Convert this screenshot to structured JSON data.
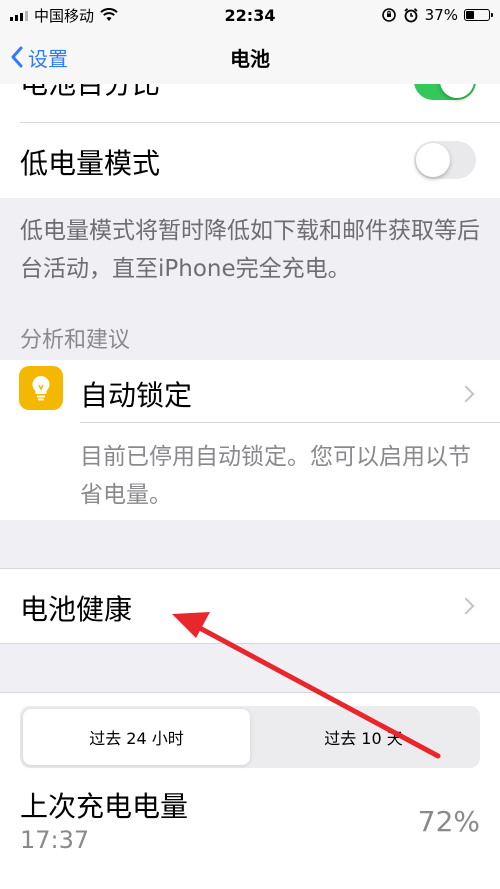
{
  "status_bar": {
    "carrier": "中国移动",
    "time": "22:34",
    "battery_percent": "37%",
    "battery_level": 0.37
  },
  "nav": {
    "back_label": "设置",
    "title": "电池"
  },
  "settings": {
    "battery_percentage": {
      "label": "电池百分比",
      "on": true
    },
    "low_power_mode": {
      "label": "低电量模式",
      "on": false
    },
    "low_power_desc": "低电量模式将暂时降低如下载和邮件获取等后台活动，直至iPhone完全充电。"
  },
  "insights": {
    "header": "分析和建议",
    "auto_lock_label": "自动锁定",
    "auto_lock_desc": "目前已停用自动锁定。您可以启用以节省电量。"
  },
  "battery_health": {
    "label": "电池健康"
  },
  "usage": {
    "tabs": [
      "过去 24 小时",
      "过去 10 天"
    ],
    "active_tab": 0,
    "last_charge_label": "上次充电电量",
    "last_charge_time": "17:37",
    "last_charge_value": "72%"
  },
  "colors": {
    "accent": "#2f7cf6",
    "toggle_on": "#34c759",
    "annotation_arrow": "#e8262b",
    "bulb_icon_bg": "#f5b800"
  }
}
